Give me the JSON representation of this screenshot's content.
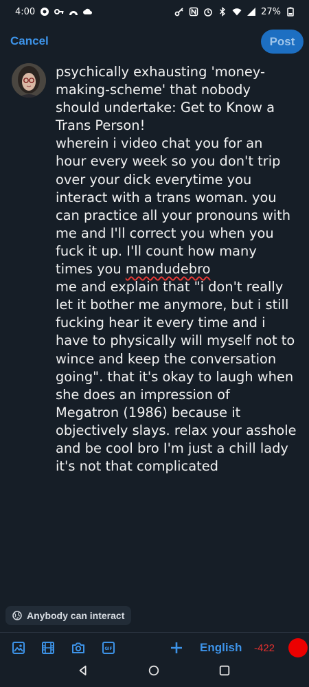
{
  "status_bar": {
    "time": "4:00",
    "battery": "27%"
  },
  "header": {
    "cancel_label": "Cancel",
    "post_label": "Post"
  },
  "post": {
    "text_before": "psychically exhausting 'money-making-scheme' that nobody should undertake: Get to Know a Trans Person!\nwherein i video chat you for an hour every week so you don't trip over your dick everytime you interact with a trans woman. you can practice all your pronouns with me and I'll correct you when you fuck it up. I'll count how many times you ",
    "misspelled_word": "mandudebro",
    "text_after": "\nme and explain that \"i don't really let it bother me anymore, but i still fucking hear it every time and i have to physically will myself not to wince and keep the conversation going\". that it's okay to laugh when she does an impression of Megatron (1986) because it objectively slays. relax your asshole and be cool bro I'm just a chill lady it's not that complicated"
  },
  "interaction": {
    "label": "Anybody can interact",
    "icon": "globe-icon"
  },
  "toolbar": {
    "icons": [
      "image-icon",
      "video-icon",
      "camera-icon",
      "gif-icon",
      "plus-icon"
    ],
    "language": "English",
    "remaining_chars": "-422"
  },
  "colors": {
    "background": "#161e27",
    "accent": "#3d93e8",
    "post_button": "#1d6fc2",
    "error": "#e0302e"
  }
}
